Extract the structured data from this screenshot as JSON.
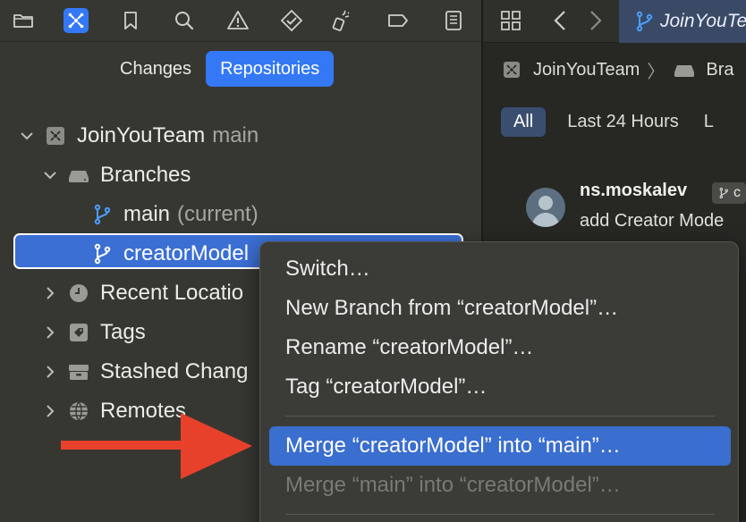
{
  "navigator": {
    "toolbar_icons": [
      "folder-icon",
      "source-control-icon",
      "bookmark-icon",
      "search-icon",
      "warning-icon",
      "test-diamond-icon",
      "debug-spray-icon",
      "breakpoint-icon",
      "report-icon"
    ],
    "segments": {
      "changes": "Changes",
      "repositories": "Repositories",
      "selected": "Repositories"
    },
    "tree": {
      "repo": {
        "name": "JoinYouTeam",
        "branch": "main"
      },
      "branches_label": "Branches",
      "branches": [
        {
          "name": "main",
          "suffix": "(current)"
        },
        {
          "name": "creatorModel",
          "suffix": ""
        }
      ],
      "groups": [
        {
          "label": "Recent Locations",
          "visible_label": "Recent Locatio"
        },
        {
          "label": "Tags"
        },
        {
          "label": "Stashed Changes",
          "visible_label": "Stashed Chang"
        },
        {
          "label": "Remotes"
        }
      ]
    }
  },
  "editor": {
    "active_tab": "JoinYouTe",
    "jumpbar": {
      "repo": "JoinYouTeam",
      "separator": "〉",
      "next": "Bra"
    },
    "filters": {
      "all": "All",
      "last24": "Last 24 Hours",
      "more": "L"
    },
    "commit": {
      "author": "ns.moskalev",
      "badge": "c",
      "message": "add Creator Mode"
    }
  },
  "context_menu": {
    "items": [
      {
        "label": "Switch…",
        "state": "normal"
      },
      {
        "label": "New Branch from “creatorModel”…",
        "state": "normal"
      },
      {
        "label": "Rename “creatorModel”…",
        "state": "normal"
      },
      {
        "label": "Tag “creatorModel”…",
        "state": "normal"
      },
      {
        "label": "Merge “creatorModel” into “main”…",
        "state": "highlighted"
      },
      {
        "label": "Merge “main” into “creatorModel”…",
        "state": "disabled"
      }
    ]
  },
  "colors": {
    "accent": "#3478f6",
    "selection": "#3b6fd4",
    "arrow": "#e8412b",
    "background": "#373732"
  }
}
